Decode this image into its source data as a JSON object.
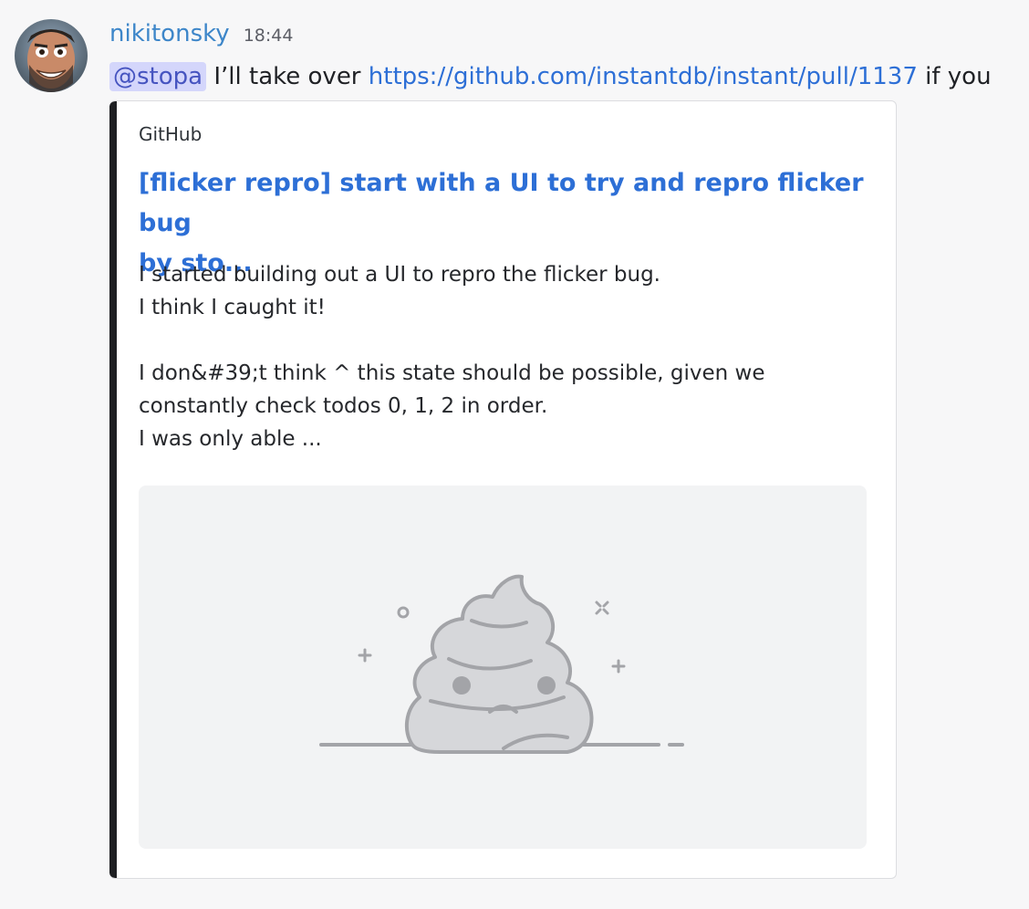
{
  "message": {
    "username": "nikitonsky",
    "timestamp": "18:44",
    "mention": "@stopa",
    "text_before_link": " I’ll take over ",
    "link": "https://github.com/instantdb/instant/pull/1137",
    "text_after_link": " if you"
  },
  "embed": {
    "provider": "GitHub",
    "title_line1": "[flicker repro] start with a UI to try and repro flicker bug",
    "title_line2": "by sto...",
    "description": [
      "I started building out a UI to repro the flicker bug.",
      "I think I caught it!",
      "",
      "I don&#39;t think ^ this state should be possible, given we",
      "constantly check todos 0, 1, 2 in order.",
      "I was only able ..."
    ],
    "image_icon": "placeholder-poop-icon"
  },
  "colors": {
    "username": "#3d86c9",
    "link": "#2d6fd6",
    "mention_bg": "#d4d6fb",
    "embed_bar": "#1e1f22"
  }
}
